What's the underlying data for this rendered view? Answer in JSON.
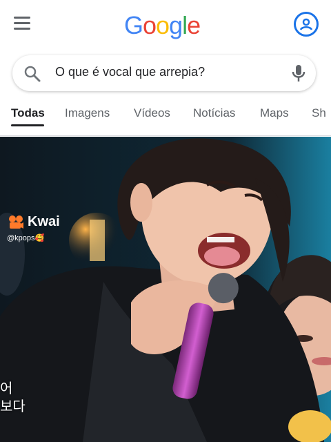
{
  "header": {
    "logo_letters": [
      {
        "ch": "G",
        "color": "#4285F4"
      },
      {
        "ch": "o",
        "color": "#EA4335"
      },
      {
        "ch": "o",
        "color": "#FBBC05"
      },
      {
        "ch": "g",
        "color": "#4285F4"
      },
      {
        "ch": "l",
        "color": "#34A853"
      },
      {
        "ch": "e",
        "color": "#EA4335"
      }
    ],
    "menu_icon": "hamburger-icon",
    "account_icon": "account-circle-icon"
  },
  "search": {
    "query": "O que é vocal que arrepia?",
    "search_icon": "search-icon",
    "mic_icon": "mic-icon"
  },
  "tabs": [
    {
      "label": "Todas",
      "active": true
    },
    {
      "label": "Imagens",
      "active": false
    },
    {
      "label": "Vídeos",
      "active": false
    },
    {
      "label": "Notícias",
      "active": false
    },
    {
      "label": "Maps",
      "active": false
    },
    {
      "label": "Sh",
      "active": false
    }
  ],
  "video": {
    "watermark": "Kwai",
    "handle": "@kpops🥰",
    "subtitle_lines": [
      "어",
      "보다"
    ]
  }
}
